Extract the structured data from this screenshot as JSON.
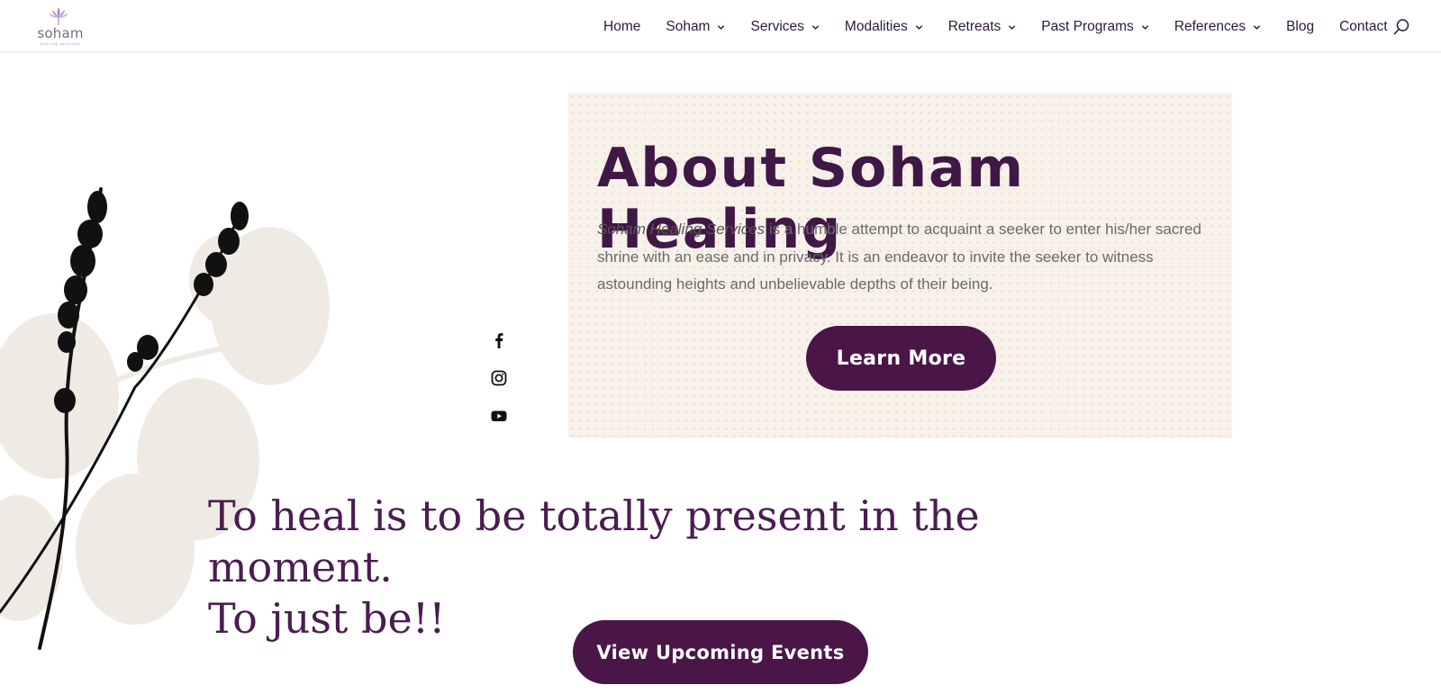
{
  "header": {
    "logo": {
      "word": "soham",
      "tagline": "healing services"
    },
    "nav": [
      {
        "label": "Home",
        "dropdown": false
      },
      {
        "label": "Soham",
        "dropdown": true
      },
      {
        "label": "Services",
        "dropdown": true
      },
      {
        "label": "Modalities",
        "dropdown": true
      },
      {
        "label": "Retreats",
        "dropdown": true
      },
      {
        "label": "Past Programs",
        "dropdown": true
      },
      {
        "label": "References",
        "dropdown": true
      },
      {
        "label": "Blog",
        "dropdown": false
      },
      {
        "label": "Contact",
        "dropdown": false
      }
    ],
    "search_icon": "search-icon"
  },
  "social": [
    {
      "icon": "facebook-icon"
    },
    {
      "icon": "instagram-icon"
    },
    {
      "icon": "youtube-icon"
    }
  ],
  "about": {
    "title": "About Soham Healing",
    "text_italic": "Soham Healing Services",
    "text_rest": " is a humble attempt to acquaint a seeker to enter his/her sacred shrine with an ease and in privacy. It is an endeavor to invite the seeker to witness astounding heights and unbelievable depths of their being.",
    "button": "Learn More"
  },
  "quote": {
    "line1": "To heal is to be totally present in the moment.",
    "line2": "To just be!!"
  },
  "events_button": "View Upcoming Events",
  "colors": {
    "brand": "#4a1648",
    "title": "#3f1845",
    "box_bg": "#f7f1ea",
    "nav_text": "#2d1a3a"
  }
}
